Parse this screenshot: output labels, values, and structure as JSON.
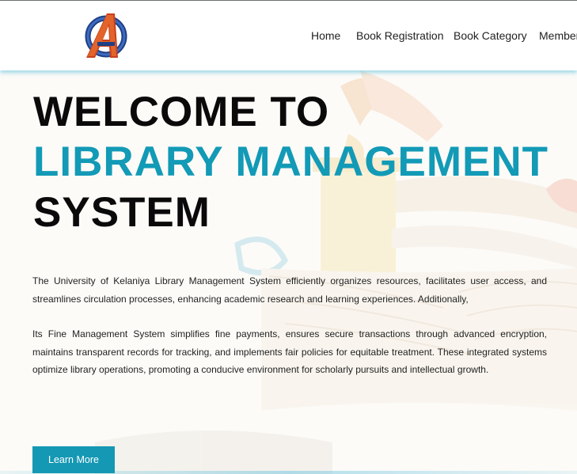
{
  "header": {
    "logo_icon": "avengers-a-logo",
    "nav": [
      {
        "label": "Home"
      },
      {
        "label": "Book Registration"
      },
      {
        "label": "Book Category"
      },
      {
        "label": "Member"
      }
    ]
  },
  "hero": {
    "title_line1": "WELCOME TO",
    "title_line2": "LIBRARY MANAGEMENT",
    "title_line3": "SYSTEM",
    "paragraph1": "The University of Kelaniya Library Management System efficiently organizes resources, facilitates user access, and streamlines circulation processes, enhancing academic research and learning experiences. Additionally,",
    "paragraph2": "Its Fine Management System simplifies fine payments, ensures secure transactions through advanced encryption, maintains transparent records for tracking, and implements fair policies for equitable treatment. These integrated systems optimize library operations, promoting a conducive environment for scholarly pursuits and intellectual growth.",
    "button_label": "Learn More"
  },
  "colors": {
    "accent": "#129ab6",
    "button": "#1598b4",
    "header_glow": "#55b9d7"
  }
}
